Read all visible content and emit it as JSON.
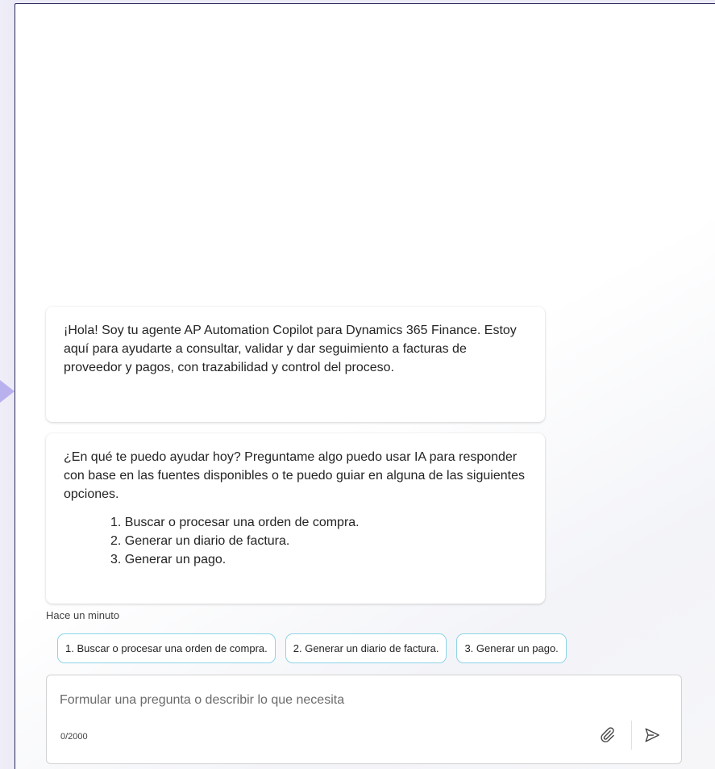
{
  "messages": [
    {
      "text": "¡Hola! Soy tu agente AP Automation Copilot para Dynamics 365 Finance. Estoy aquí para ayudarte a consultar, validar y dar seguimiento a facturas de proveedor y pagos, con trazabilidad y control del proceso."
    },
    {
      "text": "¿En qué te puedo ayudar hoy? Preguntame algo puedo usar IA para responder con base en las fuentes disponibles o te puedo guiar en alguna de las siguientes opciones.",
      "options": [
        "1. Buscar o procesar una orden de compra.",
        "2. Generar un diario de factura.",
        "3. Generar un pago."
      ]
    }
  ],
  "timestamp": "Hace un minuto",
  "suggestions": [
    "1. Buscar o procesar una orden de compra.",
    "2. Generar un diario de factura.",
    "3. Generar un pago."
  ],
  "composer": {
    "value": "",
    "placeholder": "Formular una pregunta o describir lo que necesita",
    "counter": "0/2000",
    "attach_icon": "paperclip-icon",
    "send_icon": "send-icon"
  },
  "colors": {
    "chip_border": "#8ed4e6",
    "panel_border": "#26285a",
    "side_arrow": "#b9b1ee"
  }
}
